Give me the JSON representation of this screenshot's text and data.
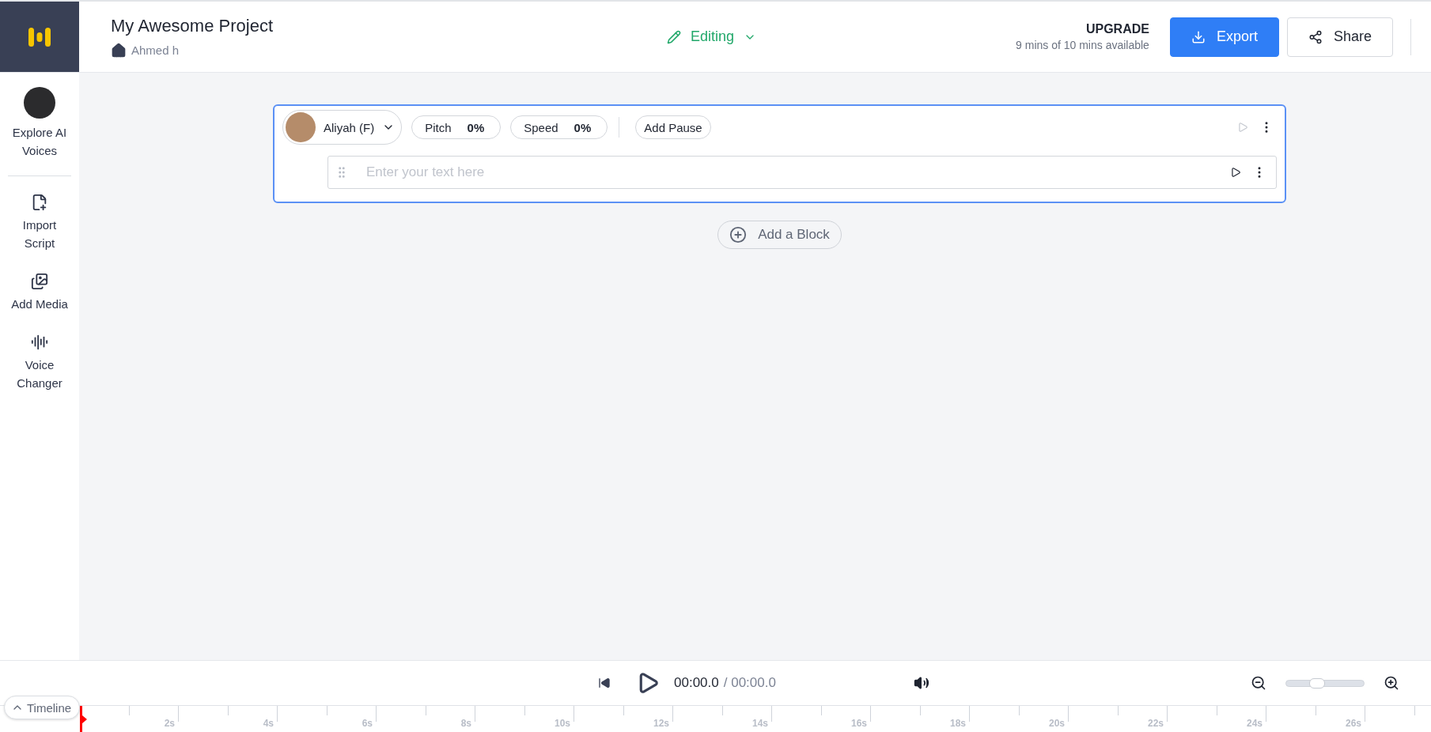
{
  "project": {
    "title": "My Awesome Project",
    "owner": "Ahmed h"
  },
  "mode": {
    "label": "Editing"
  },
  "upgrade": {
    "title": "UPGRADE",
    "usage": "9 mins of 10 mins available"
  },
  "actions": [
    {
      "kind": "primary",
      "label": "Export"
    },
    {
      "kind": "secondary",
      "label": "Share"
    }
  ],
  "sidebar": {
    "items": [
      {
        "kind": "avatar",
        "label": "Explore AI Voices"
      },
      {
        "kind": "import",
        "label": "Import Script"
      },
      {
        "kind": "media",
        "label": "Add Media"
      },
      {
        "kind": "voice",
        "label": "Voice Changer"
      }
    ]
  },
  "block": {
    "voice": "Aliyah (F)",
    "pitch": {
      "label": "Pitch",
      "value": "0%"
    },
    "speed": {
      "label": "Speed",
      "value": "0%"
    },
    "pause": "Add Pause",
    "placeholder": "Enter your text here"
  },
  "add_block": "Add a Block",
  "player": {
    "current": "00:00.0",
    "total": "/ 00:00.0",
    "zoom": {
      "level": 0.4
    }
  },
  "timeline": {
    "toggle": "Timeline",
    "labels": [
      "2s",
      "4s",
      "6s",
      "8s",
      "10s",
      "12s",
      "14s",
      "16s",
      "18s",
      "20s",
      "22s",
      "24s",
      "26s"
    ]
  }
}
